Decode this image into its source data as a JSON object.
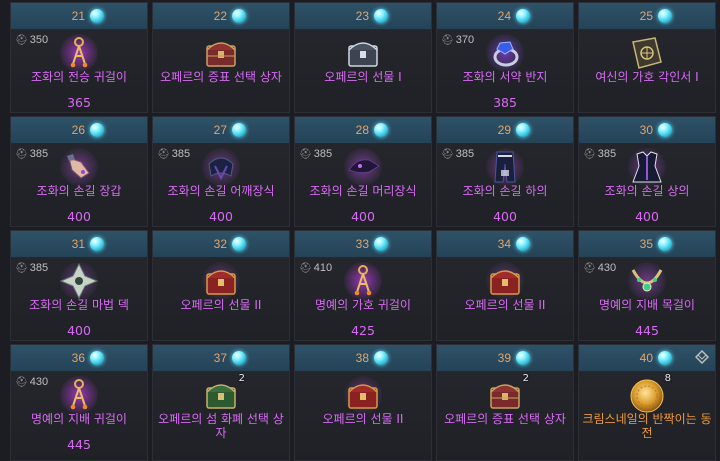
{
  "cards": [
    {
      "day": "21",
      "ilvl": "350",
      "name": "조화의 전승 귀걸이",
      "value": "365",
      "icon": "earring-icon"
    },
    {
      "day": "22",
      "name": "오페르의 증표 선택 상자",
      "icon": "chest-icon"
    },
    {
      "day": "23",
      "name": "오페르의 선물 I",
      "icon": "silver-chest-icon"
    },
    {
      "day": "24",
      "ilvl": "370",
      "name": "조화의 서약 반지",
      "value": "385",
      "icon": "ring-icon"
    },
    {
      "day": "25",
      "name": "여신의 가호 각인서 I",
      "icon": "engraving-book-icon"
    },
    {
      "day": "26",
      "ilvl": "385",
      "name": "조화의 손길 장갑",
      "value": "400",
      "icon": "gloves-icon"
    },
    {
      "day": "27",
      "ilvl": "385",
      "name": "조화의 손길 어깨장식",
      "value": "400",
      "icon": "shoulder-icon"
    },
    {
      "day": "28",
      "ilvl": "385",
      "name": "조화의 손길 머리장식",
      "value": "400",
      "icon": "helmet-icon"
    },
    {
      "day": "29",
      "ilvl": "385",
      "name": "조화의 손길 하의",
      "value": "400",
      "icon": "pants-icon"
    },
    {
      "day": "30",
      "ilvl": "385",
      "name": "조화의 손길 상의",
      "value": "400",
      "icon": "chest-armor-icon"
    },
    {
      "day": "31",
      "ilvl": "385",
      "name": "조화의 손길 마법 덱",
      "value": "400",
      "icon": "card-deck-icon"
    },
    {
      "day": "32",
      "name": "오페르의 선물 II",
      "icon": "red-chest-icon"
    },
    {
      "day": "33",
      "ilvl": "410",
      "name": "명예의 가호 귀걸이",
      "value": "425",
      "icon": "earring-icon"
    },
    {
      "day": "34",
      "name": "오페르의 선물 II",
      "icon": "red-chest-icon"
    },
    {
      "day": "35",
      "ilvl": "430",
      "name": "명예의 지배 목걸이",
      "value": "445",
      "icon": "necklace-icon"
    },
    {
      "day": "36",
      "ilvl": "430",
      "name": "명예의 지배 귀걸이",
      "value": "445",
      "icon": "earring-icon"
    },
    {
      "day": "37",
      "name": "오페르의 섬 화폐 선택 상자",
      "qty": "2",
      "icon": "green-chest-icon"
    },
    {
      "day": "38",
      "name": "오페르의 선물 II",
      "icon": "red-chest-icon"
    },
    {
      "day": "39",
      "name": "오페르의 증표 선택 상자",
      "qty": "2",
      "icon": "chest-icon"
    },
    {
      "day": "40",
      "name": "크림스네일의 반짝이는 동전",
      "qty": "8",
      "icon": "gold-coin-icon",
      "legendary": true,
      "mark": "diamond-mark-icon"
    }
  ]
}
